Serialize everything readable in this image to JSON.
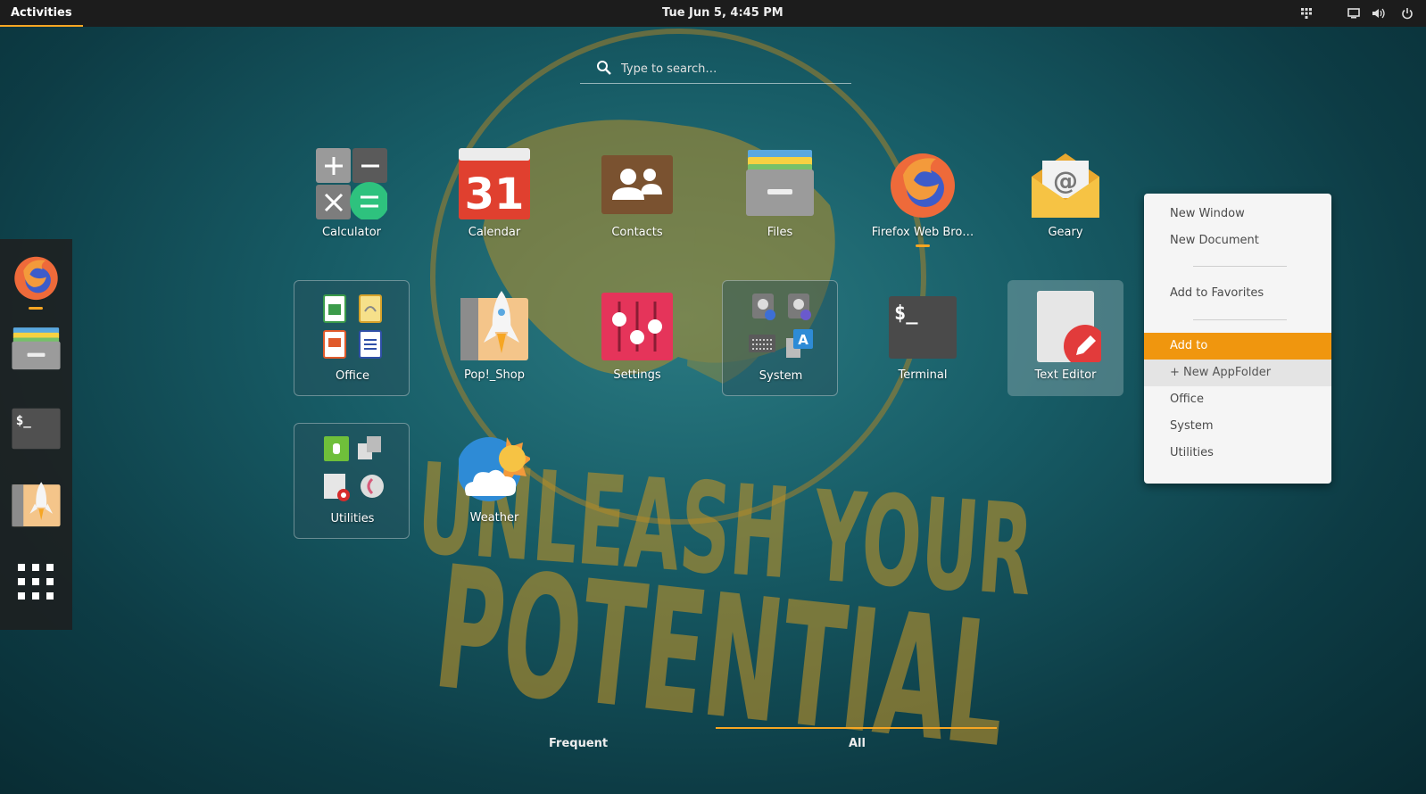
{
  "topbar": {
    "activities_label": "Activities",
    "clock": "Tue Jun  5,  4:45 PM",
    "tray_icons": [
      "network-icon",
      "display-icon",
      "volume-icon",
      "power-icon"
    ]
  },
  "search": {
    "placeholder": "Type to search…"
  },
  "dock": {
    "items": [
      "firefox-icon",
      "files-icon",
      "terminal-icon",
      "pop-shop-icon",
      "show-apps-icon"
    ],
    "running": [
      "firefox"
    ]
  },
  "apps": [
    {
      "id": "calculator",
      "label": "Calculator"
    },
    {
      "id": "calendar",
      "label": "Calendar",
      "icon_text": "31"
    },
    {
      "id": "contacts",
      "label": "Contacts"
    },
    {
      "id": "files",
      "label": "Files"
    },
    {
      "id": "firefox",
      "label": "Firefox Web Bro…",
      "running": true
    },
    {
      "id": "geary",
      "label": "Geary",
      "icon_text": "@"
    },
    {
      "id": "office",
      "label": "Office",
      "folder": true
    },
    {
      "id": "popshop",
      "label": "Pop!_Shop"
    },
    {
      "id": "settings",
      "label": "Settings"
    },
    {
      "id": "system",
      "label": "System",
      "folder": true
    },
    {
      "id": "terminal",
      "label": "Terminal",
      "icon_text": "$_"
    },
    {
      "id": "texteditor",
      "label": "Text Editor",
      "selected": true
    },
    {
      "id": "utilities",
      "label": "Utilities",
      "folder": true
    },
    {
      "id": "weather",
      "label": "Weather"
    }
  ],
  "context_menu": {
    "items": [
      {
        "label": "New Window"
      },
      {
        "label": "New Document"
      },
      {
        "label": "Add to Favorites"
      },
      {
        "label": "Add to",
        "state": "active"
      },
      {
        "label": "+ New AppFolder"
      },
      {
        "label": "Office"
      },
      {
        "label": "System"
      },
      {
        "label": "Utilities"
      }
    ]
  },
  "view_tabs": [
    {
      "label": "Frequent"
    },
    {
      "label": "All",
      "selected": true
    }
  ],
  "colors": {
    "accent": "#f6a623",
    "menu_active": "#f0960e",
    "topbar": "#1c1c1c"
  }
}
